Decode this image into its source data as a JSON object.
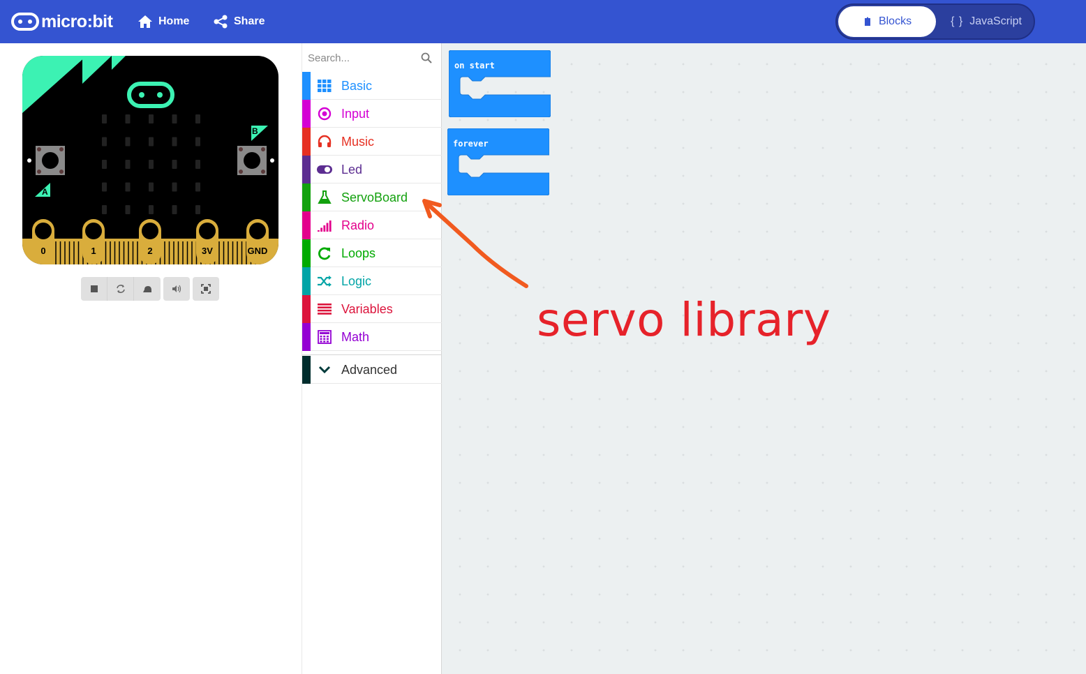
{
  "header": {
    "logo_text": "micro:bit",
    "nav": {
      "home_label": "Home",
      "share_label": "Share"
    },
    "editor_toggle": {
      "blocks_label": "Blocks",
      "javascript_label": "JavaScript",
      "javascript_prefix": "{ }",
      "active": "Blocks"
    }
  },
  "simulator": {
    "pins": [
      "0",
      "1",
      "2",
      "3V",
      "GND"
    ],
    "button_a": "A",
    "button_b": "B",
    "controls": [
      "stop",
      "restart",
      "slow-mo",
      "mute",
      "fullscreen"
    ]
  },
  "toolbox": {
    "search_placeholder": "Search...",
    "categories": [
      {
        "label": "Basic",
        "color": "#1e90ff",
        "icon": "grid-icon"
      },
      {
        "label": "Input",
        "color": "#d400d4",
        "icon": "target-icon"
      },
      {
        "label": "Music",
        "color": "#e63022",
        "icon": "headphones-icon"
      },
      {
        "label": "Led",
        "color": "#5c2d91",
        "icon": "toggle-icon"
      },
      {
        "label": "ServoBoard",
        "color": "#13a10e",
        "icon": "flask-icon"
      },
      {
        "label": "Radio",
        "color": "#e3008c",
        "icon": "signal-icon"
      },
      {
        "label": "Loops",
        "color": "#00aa00",
        "icon": "refresh-icon"
      },
      {
        "label": "Logic",
        "color": "#00a4a6",
        "icon": "shuffle-icon"
      },
      {
        "label": "Variables",
        "color": "#dc143c",
        "icon": "list-icon"
      },
      {
        "label": "Math",
        "color": "#9400d3",
        "icon": "calculator-icon"
      }
    ],
    "advanced": {
      "label": "Advanced",
      "color": "#002d2d",
      "icon": "chevron-down-icon"
    }
  },
  "workspace": {
    "blocks": [
      {
        "label": "on start",
        "color": "#1e90ff"
      },
      {
        "label": "forever",
        "color": "#1e90ff"
      }
    ],
    "annotation": {
      "text": "servo library",
      "color": "#e6222a"
    },
    "arrow_color": "#f15a1f"
  }
}
